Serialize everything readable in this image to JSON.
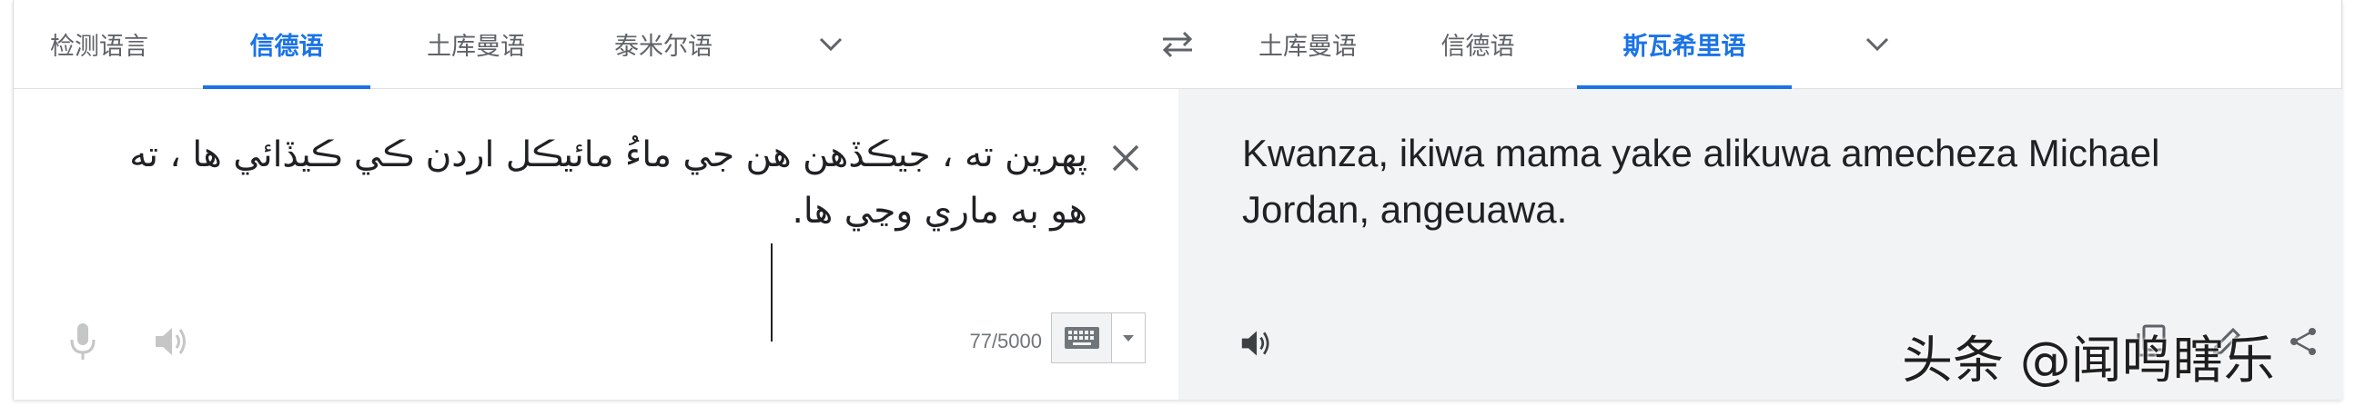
{
  "source_tabs": [
    {
      "label": "检测语言",
      "active": false
    },
    {
      "label": "信德语",
      "active": true
    },
    {
      "label": "土库曼语",
      "active": false
    },
    {
      "label": "泰米尔语",
      "active": false
    }
  ],
  "target_tabs": [
    {
      "label": "土库曼语",
      "active": false
    },
    {
      "label": "信德语",
      "active": false
    },
    {
      "label": "斯瓦希里语",
      "active": true
    }
  ],
  "icons": {
    "more_source": "chevron-down-icon",
    "swap": "swap-arrows-icon",
    "more_target": "chevron-down-icon",
    "clear": "close-icon",
    "mic": "microphone-icon",
    "listen_source": "speaker-icon",
    "keyboard": "keyboard-icon",
    "listen_target": "speaker-icon",
    "copy": "copy-icon",
    "edit": "pencil-icon",
    "share": "share-icon"
  },
  "source": {
    "text": "پھرين ته ، جيڪڏهن هن جي ماءُ مائيڪل اردن ڪي ڪيڏائي ها ، ته هو به ماري وڃي ها.",
    "char_count": "77/5000"
  },
  "target": {
    "text": "Kwanza, ikiwa mama yake alikuwa amecheza Michael Jordan, angeuawa."
  },
  "watermark": "头条 @闻鸣瞎乐",
  "colors": {
    "accent": "#1a73e8",
    "tab_text": "#5f6368",
    "icon": "#9aa0a6",
    "target_bg": "#f1f3f4"
  }
}
